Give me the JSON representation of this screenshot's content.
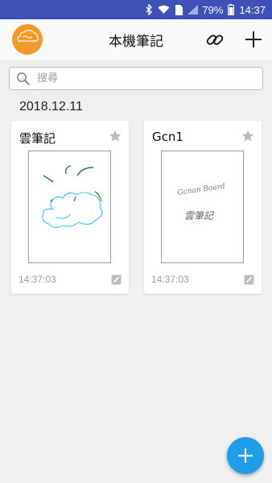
{
  "status_bar": {
    "battery": "79%",
    "time": "14:37",
    "sim_label": "1",
    "icons": [
      "bluetooth-icon",
      "wifi-icon",
      "sim-icon",
      "signal-icon",
      "battery-icon"
    ]
  },
  "header": {
    "title": "本機筆記",
    "logo_text": "雲筆記",
    "logo_color": "#f39a2b",
    "icons": [
      "link-icon",
      "plus-icon"
    ]
  },
  "search": {
    "placeholder": "搜尋",
    "value": ""
  },
  "date_group": "2018.12.11",
  "notes": [
    {
      "title": "雲筆記",
      "time": "14:37:03",
      "sketch": "green strokes and blue cloud drawing"
    },
    {
      "title": "Gcn1",
      "time": "14:37:03",
      "handwriting_1": "Gcnan Board",
      "handwriting_2": "雲筆記"
    }
  ],
  "colors": {
    "status_bar": "#3f51b5",
    "fab": "#1e9ee8",
    "accent": "#f39a2b"
  }
}
